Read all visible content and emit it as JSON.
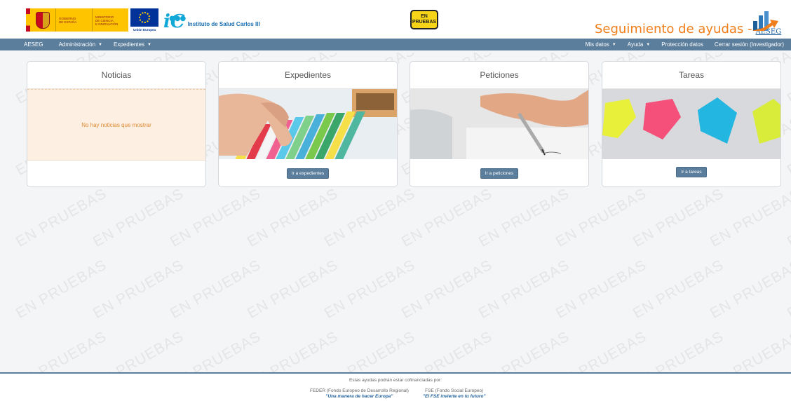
{
  "header": {
    "gov_line1": "GOBIERNO",
    "gov_line2": "DE ESPAÑA",
    "ministry_line1": "MINISTERIO",
    "ministry_line2": "DE CIENCIA",
    "ministry_line3": "E INNOVACIÓN",
    "eu_label": "Unión Europea",
    "institute_name": "Instituto de Salud Carlos III",
    "test_badge_line1": "EN",
    "test_badge_line2": "PRUEBAS",
    "app_title": "Seguimiento de ayudas -",
    "app_subtitle": "AESEG"
  },
  "navbar": {
    "left": [
      {
        "label": "AESEG",
        "dropdown": false
      },
      {
        "label": "Administración",
        "dropdown": true
      },
      {
        "label": "Expedientes",
        "dropdown": true
      }
    ],
    "right": [
      {
        "label": "Mis datos",
        "dropdown": true
      },
      {
        "label": "Ayuda",
        "dropdown": true
      },
      {
        "label": "Protección datos",
        "dropdown": false
      },
      {
        "label": "Cerrar sesión (Investigador)",
        "dropdown": false
      }
    ]
  },
  "cards": {
    "noticias": {
      "title": "Noticias",
      "empty_message": "No hay noticias que mostrar"
    },
    "expedientes": {
      "title": "Expedientes",
      "button": "Ir a expedientes"
    },
    "peticiones": {
      "title": "Peticiones",
      "button": "Ir a peticiones"
    },
    "tareas": {
      "title": "Tareas",
      "button": "Ir a tareas"
    }
  },
  "watermark": "EN PRUEBAS",
  "footer": {
    "intro": "Estas ayudas podrán estar cofinanciadas por:",
    "feder_name": "FEDER (Fondo Europeo de Desarrollo Regional)",
    "feder_motto": "\"Una manera de hacer Europa\"",
    "fse_name": "FSE (Fondo Social Europeo)",
    "fse_motto": "\"El FSE invierte en tu futuro\""
  },
  "colors": {
    "navbar": "#5b7e9c",
    "title_orange": "#f07f1b",
    "news_bg": "#fdf0e2",
    "news_text": "#e0882f"
  }
}
